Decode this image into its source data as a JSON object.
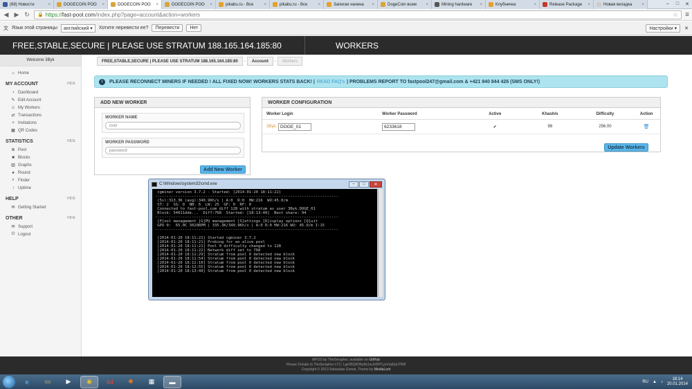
{
  "browser": {
    "tabs": [
      {
        "label": "(68) Новости",
        "color": "#3b5998",
        "active": false
      },
      {
        "label": "DOGECOIN POO",
        "color": "#d8a53b",
        "active": false
      },
      {
        "label": "DOGECOIN POO",
        "color": "#d8a53b",
        "active": true
      },
      {
        "label": "DOGECOIN POO",
        "color": "#d8a53b",
        "active": false
      },
      {
        "label": "pikabu.ru - Все",
        "color": "#e6a02c",
        "active": false
      },
      {
        "label": "pikabu.ru - Все",
        "color": "#e6a02c",
        "active": false
      },
      {
        "label": "Записки начина",
        "color": "#e6a02c",
        "active": false
      },
      {
        "label": "DogeCoin всем",
        "color": "#d8a53b",
        "active": false
      },
      {
        "label": "Mining hardware",
        "color": "#555555",
        "active": false
      },
      {
        "label": "Клубничка",
        "color": "#e6a02c",
        "active": false
      },
      {
        "label": "Release Package",
        "color": "#c0392b",
        "active": false
      },
      {
        "label": "Новая вкладка",
        "color": "#cccccc",
        "active": false
      }
    ],
    "url_scheme": "https://",
    "url_host": "fast-pool.com",
    "url_rest": "/index.php?page=account&action=workers",
    "translate": {
      "prefix": "Язык этой страницы",
      "language": "английский",
      "question": "Хотите перевести ее?",
      "translate_btn": "Перевести",
      "no_btn": "Нет",
      "settings_btn": "Настройки"
    }
  },
  "header": {
    "title": "FREE,STABLE,SECURE | PLEASE USE STRATUM 188.165.164.185:80",
    "page": "WORKERS"
  },
  "sidebar": {
    "welcome": "Welcome 3Byk",
    "home": "Home",
    "sections": [
      {
        "title": "MY ACCOUNT",
        "hide": "HIDE",
        "items": [
          "Dashboard",
          "Edit Account",
          "My Workers",
          "Transactions",
          "Invitations",
          "QR Codes"
        ]
      },
      {
        "title": "STATISTICS",
        "hide": "HIDE",
        "items": [
          "Pool",
          "Blocks",
          "Graphs",
          "Round",
          "Finder",
          "Uptime"
        ]
      },
      {
        "title": "HELP",
        "hide": "HIDE",
        "items": [
          "Getting Started"
        ]
      },
      {
        "title": "OTHER",
        "hide": "HIDE",
        "items": [
          "Support",
          "Logout"
        ]
      }
    ]
  },
  "breadcrumb": [
    "FREE,STABLE,SECURE | PLEASE USE STRATUM 188.165.164.185:80",
    "Account",
    "Workers"
  ],
  "alert": {
    "text1": "PLEASE RECONNECT MINERS IF NEEDED ! ALL FIXED NOW! WORKERS STATS BACK! |",
    "link": "READ FAQ's",
    "text2": "| PROBLEMS REPORT TO fastpool247@gmail.com & +421 940 844 426 (SMS ONLY!)"
  },
  "add_worker": {
    "title": "ADD NEW WORKER",
    "name_label": "WORKER NAME",
    "name_placeholder": "user",
    "pass_label": "WORKER PASSWORD",
    "pass_placeholder": "password",
    "button": "Add New Worker"
  },
  "config": {
    "title": "WORKER CONFIGURATION",
    "columns": [
      "Worker Login",
      "Worker Password",
      "Active",
      "Khash/s",
      "Difficulty",
      "Action"
    ],
    "row": {
      "prefix": "3Byk.",
      "login": "DOGE_01",
      "password": "6233618",
      "active": "✔",
      "khash": "98",
      "difficulty": "256.00"
    },
    "button": "Update Workers"
  },
  "cmd": {
    "title": "C:\\Windows\\system32\\cmd.exe",
    "lines": [
      " cgminer version 3.7.2 - Started: [2014-01-20 18:11:22]",
      "--------------------------------------------------------------------------------",
      " (5s):313.3K (avg):340.9Kh/s | A:0  R:0  HW:216  WU:45.0/m",
      " ST: 2  SS: 0  NB: 6  LW: 25  GF: 0  RF: 0",
      " Connected to fast-pool.com diff 128 with stratum as user 3Byk.DOGE_01",
      " Block: 54011dde...  Diff:768  Started: [18:13:40]  Best share: 94",
      "--------------------------------------------------------------------------------",
      " [P]ool management [G]PU management [S]ettings [D]isplay options [Q]uit",
      " GPU 0:  65.0C 3020RPM | 335.3K/340.9Kh/s | A:0 R:0 HW:216 WU: 45.0/m I:15",
      "--------------------------------------------------------------------------------",
      "",
      " [2014-01-20 18:11:21] Started cgminer 3.7.2",
      " [2014-01-20 18:11:21] Probing for an alive pool",
      " [2014-01-20 18:11:21] Pool 0 difficulty changed to 128",
      " [2014-01-20 18:11:22] Network diff set to 768",
      " [2014-01-20 18:11:29] Stratum from pool 0 detected new block",
      " [2014-01-20 18:11:54] Stratum from pool 0 detected new block",
      " [2014-01-20 18:12:10] Stratum from pool 0 detected new block",
      " [2014-01-20 18:12:55] Stratum from pool 0 detected new block",
      " [2014-01-20 18:13:40] Stratum from pool 0 detected new block"
    ]
  },
  "footer": {
    "line1a": "MPOS by TheSerapher, available on",
    "line1b": "GitHub",
    "line2": "Please Donate to TheSerapher LTC: Lge95QR2frp9y1wJvt5PCyxVsq5pLPW8",
    "line3a": "Copyright © 2013 Sebastian Grewe, Theme by",
    "line3b": "MediaLoot"
  },
  "taskbar": {
    "lang": "RU",
    "time": "18:14",
    "date": "20.01.2014"
  }
}
